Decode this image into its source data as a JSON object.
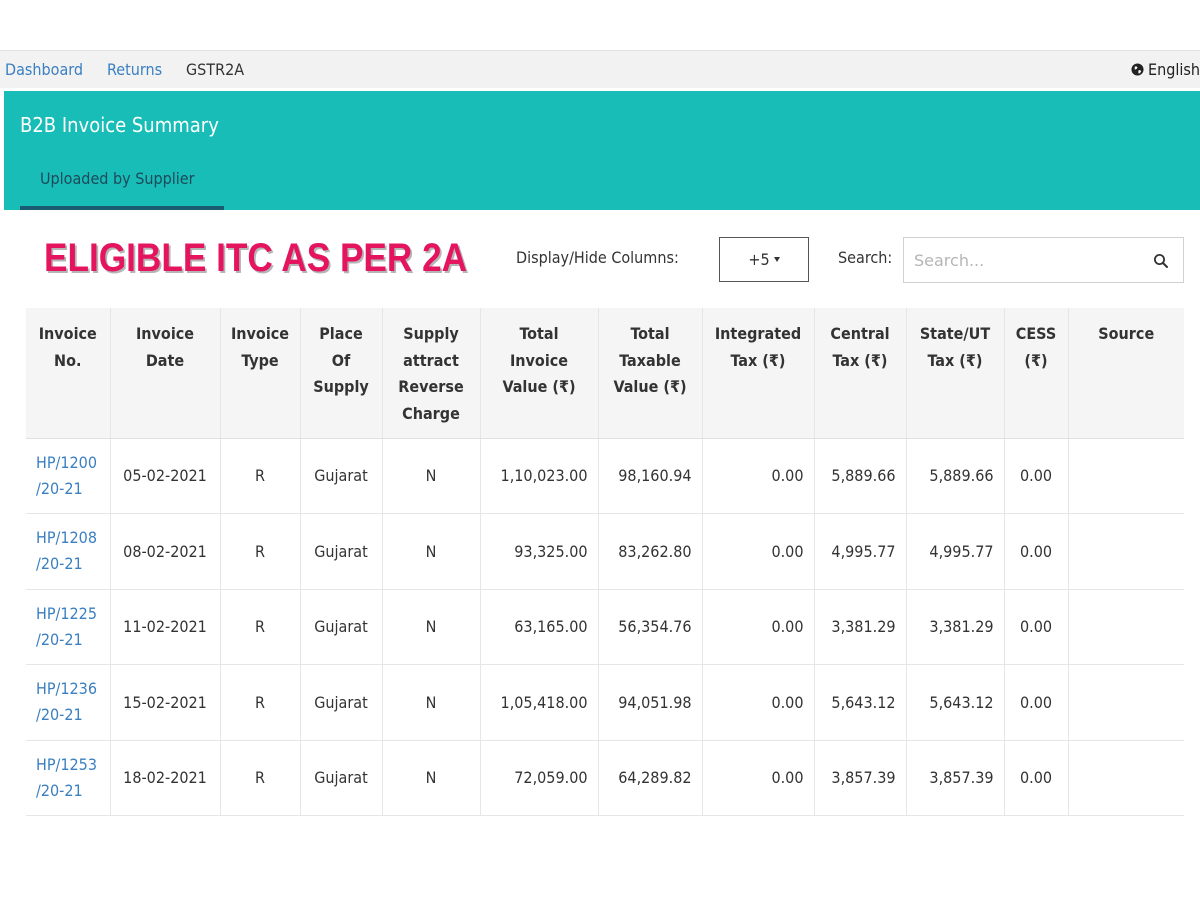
{
  "breadcrumb": {
    "dashboard": "Dashboard",
    "returns": "Returns",
    "current": "GSTR2A"
  },
  "language": "English",
  "panel": {
    "title": "B2B Invoice Summary",
    "tab": "Uploaded by Supplier"
  },
  "banner": "ELIGIBLE ITC AS PER 2A",
  "toolbar": {
    "display_hide_label": "Display/Hide Columns:",
    "columns_button": "+5",
    "search_label": "Search:",
    "search_placeholder": "Search..."
  },
  "table": {
    "headers": [
      [
        "Invoice",
        "No."
      ],
      [
        "Invoice",
        "Date"
      ],
      [
        "Invoice",
        "Type"
      ],
      [
        "Place",
        "Of",
        "Supply"
      ],
      [
        "Supply",
        "attract",
        "Reverse",
        "Charge"
      ],
      [
        "Total",
        "Invoice",
        "Value (₹)"
      ],
      [
        "Total",
        "Taxable",
        "Value (₹)"
      ],
      [
        "Integrated",
        "Tax (₹)"
      ],
      [
        "Central",
        "Tax (₹)"
      ],
      [
        "State/UT",
        "Tax (₹)"
      ],
      [
        "CESS",
        "(₹)"
      ],
      [
        "Source"
      ]
    ],
    "rows": [
      {
        "invoice_no": [
          "HP/1200",
          "/20-21"
        ],
        "date": "05-02-2021",
        "type": "R",
        "place": "Gujarat",
        "reverse": "N",
        "invoice_value": "1,10,023.00",
        "taxable_value": "98,160.94",
        "igst": "0.00",
        "cgst": "5,889.66",
        "sgst": "5,889.66",
        "cess": "0.00",
        "source": ""
      },
      {
        "invoice_no": [
          "HP/1208",
          "/20-21"
        ],
        "date": "08-02-2021",
        "type": "R",
        "place": "Gujarat",
        "reverse": "N",
        "invoice_value": "93,325.00",
        "taxable_value": "83,262.80",
        "igst": "0.00",
        "cgst": "4,995.77",
        "sgst": "4,995.77",
        "cess": "0.00",
        "source": ""
      },
      {
        "invoice_no": [
          "HP/1225",
          "/20-21"
        ],
        "date": "11-02-2021",
        "type": "R",
        "place": "Gujarat",
        "reverse": "N",
        "invoice_value": "63,165.00",
        "taxable_value": "56,354.76",
        "igst": "0.00",
        "cgst": "3,381.29",
        "sgst": "3,381.29",
        "cess": "0.00",
        "source": ""
      },
      {
        "invoice_no": [
          "HP/1236",
          "/20-21"
        ],
        "date": "15-02-2021",
        "type": "R",
        "place": "Gujarat",
        "reverse": "N",
        "invoice_value": "1,05,418.00",
        "taxable_value": "94,051.98",
        "igst": "0.00",
        "cgst": "5,643.12",
        "sgst": "5,643.12",
        "cess": "0.00",
        "source": ""
      },
      {
        "invoice_no": [
          "HP/1253",
          "/20-21"
        ],
        "date": "18-02-2021",
        "type": "R",
        "place": "Gujarat",
        "reverse": "N",
        "invoice_value": "72,059.00",
        "taxable_value": "64,289.82",
        "igst": "0.00",
        "cgst": "3,857.39",
        "sgst": "3,857.39",
        "cess": "0.00",
        "source": ""
      }
    ]
  }
}
